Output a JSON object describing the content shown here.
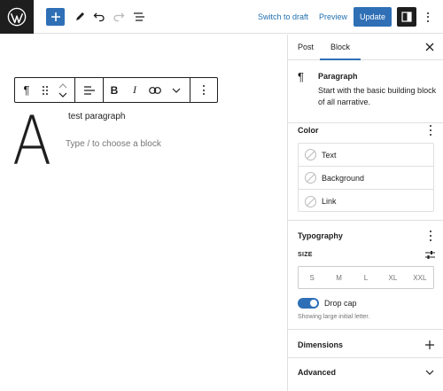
{
  "topbar": {
    "switch_to_draft": "Switch to draft",
    "preview": "Preview",
    "update": "Update"
  },
  "editor": {
    "drop_cap_letter": "A",
    "paragraph_text": "test paragraph",
    "block_placeholder": "Type / to choose a block"
  },
  "sidebar": {
    "tabs": [
      "Post",
      "Block"
    ],
    "active_tab": "Block",
    "block_card": {
      "title": "Paragraph",
      "description": "Start with the basic building block of all narrative."
    },
    "color": {
      "title": "Color",
      "items": [
        "Text",
        "Background",
        "Link"
      ]
    },
    "typography": {
      "title": "Typography",
      "size_label": "SIZE",
      "size_options": [
        "S",
        "M",
        "L",
        "XL",
        "XXL"
      ],
      "drop_cap_label": "Drop cap",
      "drop_cap_enabled": true,
      "drop_cap_help": "Showing large initial letter."
    },
    "dimensions_title": "Dimensions",
    "advanced_title": "Advanced"
  },
  "colors": {
    "accent": "#2f6fb6",
    "dark": "#1e1e1e",
    "border": "#e0e0e0",
    "muted": "#757575"
  }
}
